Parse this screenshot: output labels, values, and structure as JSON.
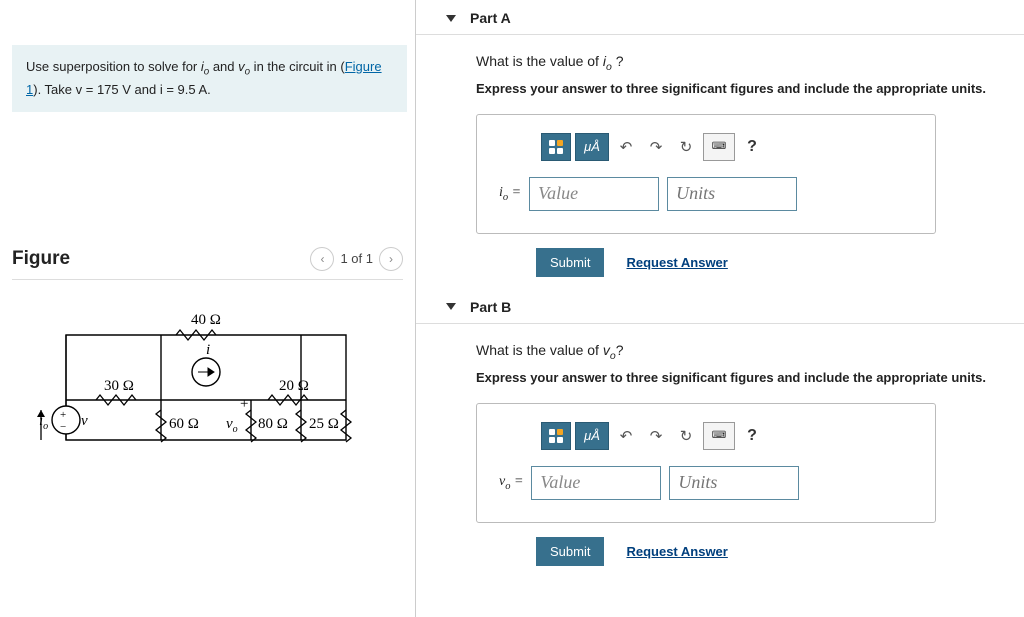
{
  "problem": {
    "text_prefix": "Use superposition to solve for ",
    "io_html": "i<sub>o</sub>",
    "and_txt": " and ",
    "vo_html": "v<sub>o</sub>",
    "text_mid": " in the circuit in (",
    "figure_link": "Figure 1",
    "text_suffix": "). Take v = 175 V and i = 9.5 A."
  },
  "figure": {
    "title": "Figure",
    "pager": "1 of 1",
    "prev_glyph": "‹",
    "next_glyph": "›",
    "labels": {
      "r40": "40 Ω",
      "r30": "30 Ω",
      "r20": "20 Ω",
      "r60": "60 Ω",
      "r80": "80 Ω",
      "r25": "25 Ω",
      "io": "i",
      "o": "o",
      "v": "v",
      "vo": "v",
      "i_top": "i",
      "plus": "+",
      "minus": "−"
    }
  },
  "toolbar": {
    "mua": "μÅ",
    "undo": "↶",
    "redo": "↷",
    "reset": "↻",
    "help": "?"
  },
  "partA": {
    "header": "Part A",
    "question_pre": "What is the value of ",
    "question_var": "i<sub>o</sub> ",
    "question_post": "?",
    "instructions": "Express your answer to three significant figures and include the appropriate units.",
    "var_label": "i<sub>o</sub> =",
    "value_ph": "Value",
    "units_ph": "Units",
    "submit": "Submit",
    "request": "Request Answer"
  },
  "partB": {
    "header": "Part B",
    "question_pre": "What is the value of ",
    "question_var": "v<sub>o</sub>",
    "question_post": "?",
    "instructions": "Express your answer to three significant figures and include the appropriate units.",
    "var_label": "v<sub>o</sub> =",
    "value_ph": "Value",
    "units_ph": "Units",
    "submit": "Submit",
    "request": "Request Answer"
  }
}
